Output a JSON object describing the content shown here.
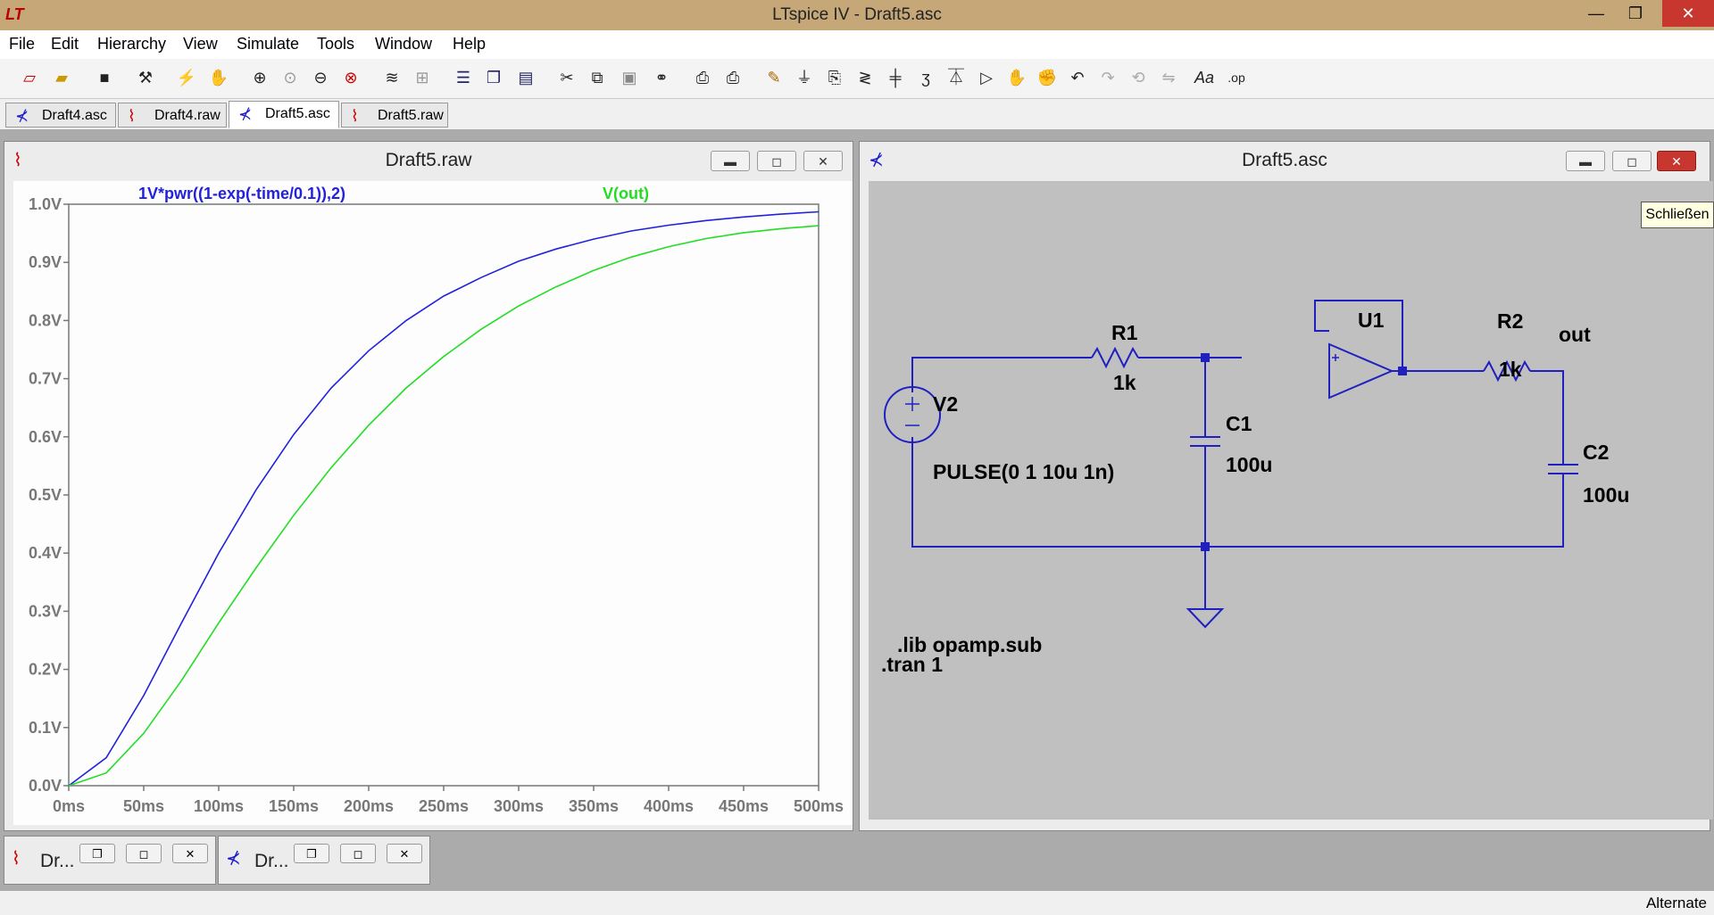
{
  "window": {
    "title": "LTspice IV - Draft5.asc",
    "minimize": "—",
    "maximize": "❐",
    "close": "✕"
  },
  "menu": [
    "File",
    "Edit",
    "Hierarchy",
    "View",
    "Simulate",
    "Tools",
    "Window",
    "Help"
  ],
  "tabs": [
    {
      "label": "Draft4.asc",
      "icon": "schematic-icon"
    },
    {
      "label": "Draft4.raw",
      "icon": "waveform-icon"
    },
    {
      "label": "Draft5.asc",
      "icon": "schematic-icon"
    },
    {
      "label": "Draft5.raw",
      "icon": "waveform-icon"
    }
  ],
  "plot_window": {
    "title": "Draft5.raw",
    "trace_labels": [
      "1V*pwr((1-exp(-time/0.1)),2)",
      "V(out)"
    ],
    "colors": {
      "trace1": "#2222dd",
      "trace2": "#22dd22"
    }
  },
  "chart_data": {
    "type": "line",
    "x": [
      0,
      25,
      50,
      75,
      100,
      125,
      150,
      175,
      200,
      225,
      250,
      275,
      300,
      325,
      350,
      375,
      400,
      425,
      450,
      475,
      500
    ],
    "series": [
      {
        "name": "1V*pwr((1-exp(-time/0.1)),2)",
        "values": [
          0,
          0.048,
          0.155,
          0.279,
          0.4,
          0.509,
          0.604,
          0.684,
          0.748,
          0.8,
          0.842,
          0.874,
          0.902,
          0.923,
          0.94,
          0.954,
          0.964,
          0.972,
          0.978,
          0.983,
          0.987
        ]
      },
      {
        "name": "V(out)",
        "values": [
          0,
          0.022,
          0.09,
          0.18,
          0.28,
          0.375,
          0.465,
          0.547,
          0.62,
          0.684,
          0.738,
          0.785,
          0.825,
          0.858,
          0.886,
          0.909,
          0.927,
          0.941,
          0.951,
          0.958,
          0.963
        ]
      }
    ],
    "x_ticks": [
      "0ms",
      "50ms",
      "100ms",
      "150ms",
      "200ms",
      "250ms",
      "300ms",
      "350ms",
      "400ms",
      "450ms",
      "500ms"
    ],
    "y_ticks": [
      "0.0V",
      "0.1V",
      "0.2V",
      "0.3V",
      "0.4V",
      "0.5V",
      "0.6V",
      "0.7V",
      "0.8V",
      "0.9V",
      "1.0V"
    ],
    "xlim": [
      0,
      500
    ],
    "ylim": [
      0,
      1.0
    ],
    "grid": false
  },
  "schematic_window": {
    "title": "Draft5.asc",
    "tooltip": "Schließen",
    "labels": {
      "r1": "R1",
      "r1_val": "1k",
      "r2": "R2",
      "r2_val": "1k",
      "u1": "U1",
      "out": "out",
      "v2": "V2",
      "v2_val": "PULSE(0 1 10u 1n)",
      "c1": "C1",
      "c1_val": "100u",
      "c2": "C2",
      "c2_val": "100u",
      "lib": ".lib opamp.sub",
      "tran": ".tran 1"
    }
  },
  "minimized": [
    {
      "label": "Dr..."
    },
    {
      "label": "Dr..."
    }
  ],
  "status": "Alternate"
}
